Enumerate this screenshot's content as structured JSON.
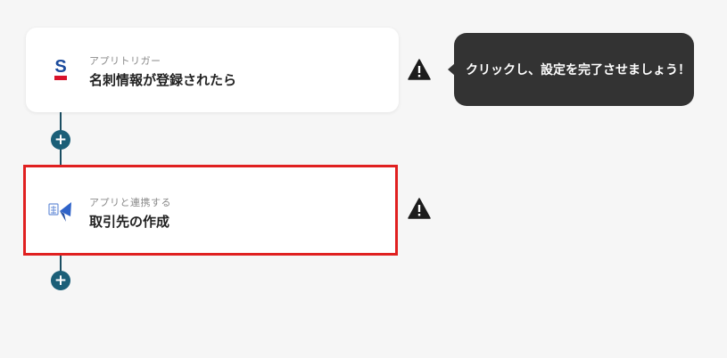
{
  "flow": {
    "trigger": {
      "icon": "sansan-logo-icon",
      "subtitle": "アプリトリガー",
      "title": "名刺情報が登録されたら"
    },
    "action": {
      "icon": "accounting-app-icon",
      "subtitle": "アプリと連携する",
      "title": "取引先の作成"
    },
    "add_label": "+",
    "warning_icon": "warning-icon"
  },
  "tooltip": {
    "text": "クリックし、設定を完了させましょう！"
  },
  "colors": {
    "connector": "#1b4e62",
    "add_button": "#1b5f78",
    "selected_border": "#e02020",
    "tooltip_bg": "#333333"
  }
}
